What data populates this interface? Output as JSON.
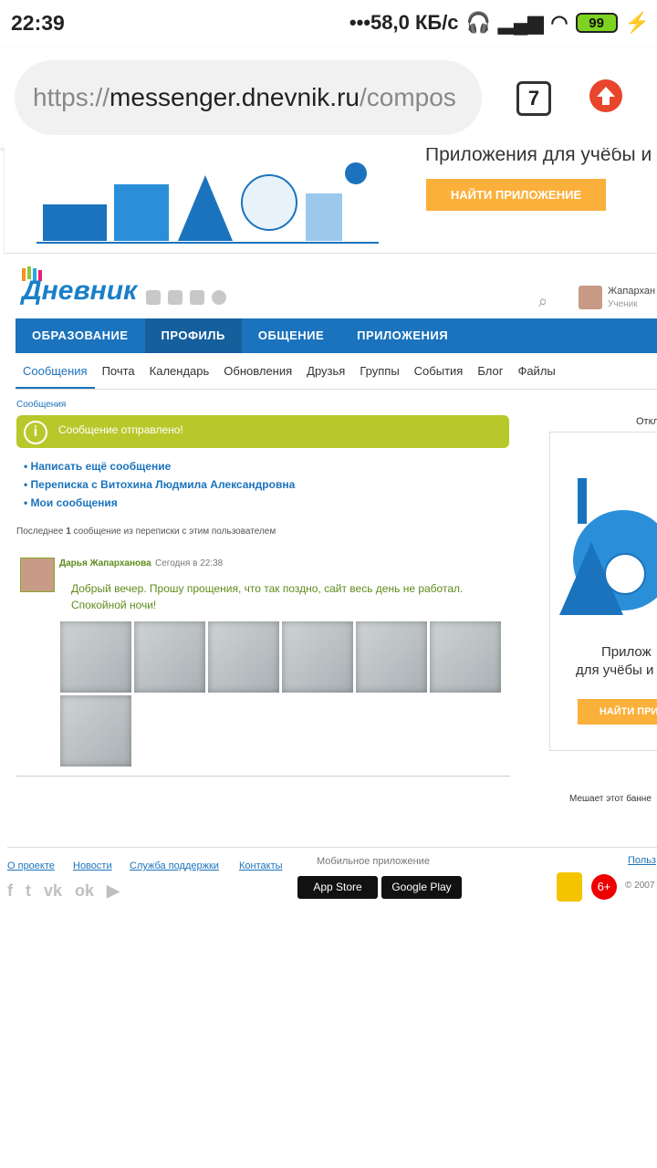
{
  "status_bar": {
    "time": "22:39",
    "speed": "•••58,0 КБ/с",
    "battery": "99"
  },
  "browser": {
    "url_scheme": "https://",
    "url_host": "messenger.dnevnik.ru",
    "url_path": "/compos",
    "tabs_count": "7"
  },
  "banner": {
    "text": "Приложения для учёбы и",
    "button": "НАЙТИ ПРИЛОЖЕНИЕ"
  },
  "header": {
    "logo": "Дневник",
    "user_name": "Жапархан",
    "user_role": "Ученик"
  },
  "main_nav": [
    "ОБРАЗОВАНИЕ",
    "ПРОФИЛЬ",
    "ОБЩЕНИЕ",
    "ПРИЛОЖЕНИЯ"
  ],
  "sub_nav": [
    "Сообщения",
    "Почта",
    "Календарь",
    "Обновления",
    "Друзья",
    "Группы",
    "События",
    "Блог",
    "Файлы"
  ],
  "content": {
    "breadcrumb": "Сообщения",
    "success_message": "Сообщение отправлено!",
    "links": [
      "Написать ещё сообщение",
      "Переписка с Витохина Людмила Александровна",
      "Мои сообщения"
    ],
    "note_prefix": "Последнее",
    "note_count": "1",
    "note_suffix": "сообщение из переписки с этим пользователем"
  },
  "message": {
    "author": "Дарья Жапарханова",
    "time": "Сегодня в 22:38",
    "body": "Добрый вечер. Прошу прощения, что так поздно, сайт весь день не работал. Спокойной ночи!",
    "attachments": 7
  },
  "side_ad": {
    "close": "Откл",
    "text1": "Прилож",
    "text2": "для учёбы и",
    "button": "НАЙТИ ПРИЛ",
    "bother": "Мешает этот банне"
  },
  "footer": {
    "links": [
      "О проекте",
      "Новости",
      "Служба поддержки",
      "Контакты"
    ],
    "mobile_label": "Мобильное приложение",
    "app_store": "App Store",
    "google_play": "Google Play",
    "rights_link": "Польз",
    "age": "6+",
    "copyright": "© 2007"
  },
  "colors": {
    "brand_blue": "#1b73bd",
    "success_green": "#b8c82b",
    "accent_orange": "#fbb03b"
  }
}
